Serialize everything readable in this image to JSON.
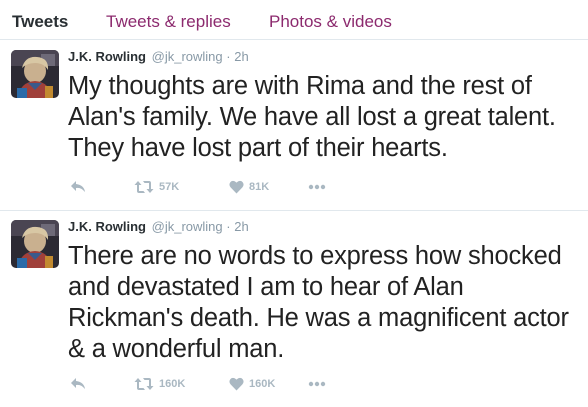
{
  "tabs": {
    "tweets": "Tweets",
    "replies": "Tweets & replies",
    "photos": "Photos & videos"
  },
  "tweets": [
    {
      "author": "J.K. Rowling",
      "handle": "@jk_rowling",
      "separator": "·",
      "time": "2h",
      "text": "My thoughts are with Rima and the rest of Alan's family. We have all lost a great talent. They have lost part of their hearts.",
      "retweets": "57K",
      "likes": "81K"
    },
    {
      "author": "J.K. Rowling",
      "handle": "@jk_rowling",
      "separator": "·",
      "time": "2h",
      "text": "There are no words to express how shocked and devastated I am to hear of Alan Rickman's death. He was a magnificent actor & a wonderful man.",
      "retweets": "160K",
      "likes": "160K"
    }
  ],
  "icons": {
    "reply": "reply-icon",
    "retweet": "retweet-icon",
    "like": "heart-icon",
    "more": "more-dots-icon"
  },
  "colors": {
    "tab_link": "#8c2a6e",
    "text": "#222222",
    "muted": "#8899a6",
    "action_icon": "#aab8c2"
  }
}
